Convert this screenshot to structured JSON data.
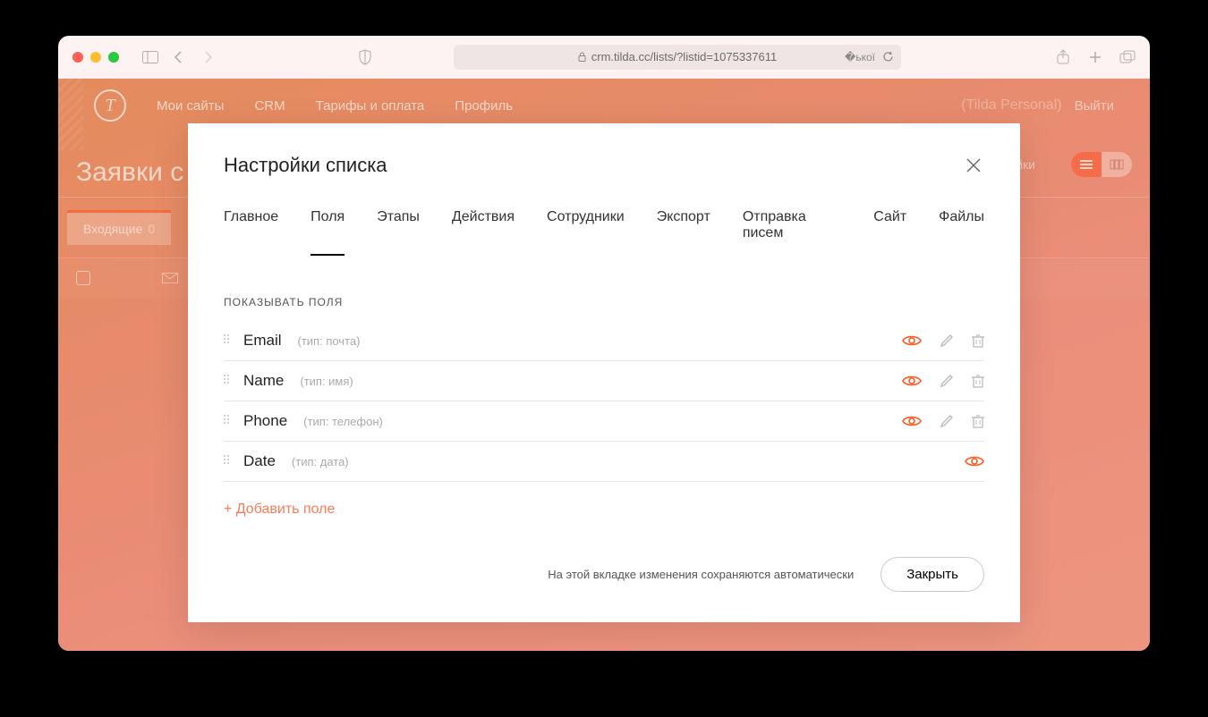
{
  "browser": {
    "url": "crm.tilda.cc/lists/?listid=1075337611"
  },
  "topnav": {
    "links": [
      "Мои сайты",
      "CRM",
      "Тарифы и оплата",
      "Профиль"
    ],
    "personal": "(Tilda Personal)",
    "logout": "Выйти"
  },
  "page": {
    "title": "Заявки с са",
    "inbox_label": "Входящие",
    "inbox_count": "0",
    "settings_link": "ойки"
  },
  "modal": {
    "title": "Настройки списка",
    "tabs": [
      "Главное",
      "Поля",
      "Этапы",
      "Действия",
      "Сотрудники",
      "Экспорт",
      "Отправка писем",
      "Сайт",
      "Файлы"
    ],
    "active_tab_index": 1,
    "section_label": "ПОКАЗЫВАТЬ ПОЛЯ",
    "fields": [
      {
        "name": "Email",
        "type": "(тип: почта)",
        "editable": true
      },
      {
        "name": "Name",
        "type": "(тип: имя)",
        "editable": true
      },
      {
        "name": "Phone",
        "type": "(тип: телефон)",
        "editable": true
      },
      {
        "name": "Date",
        "type": "(тип: дата)",
        "editable": false
      }
    ],
    "add_field": "+ Добавить поле",
    "autosave_note": "На этой вкладке изменения сохраняются автоматически",
    "close_button": "Закрыть"
  },
  "colors": {
    "accent": "#ff5a24"
  }
}
